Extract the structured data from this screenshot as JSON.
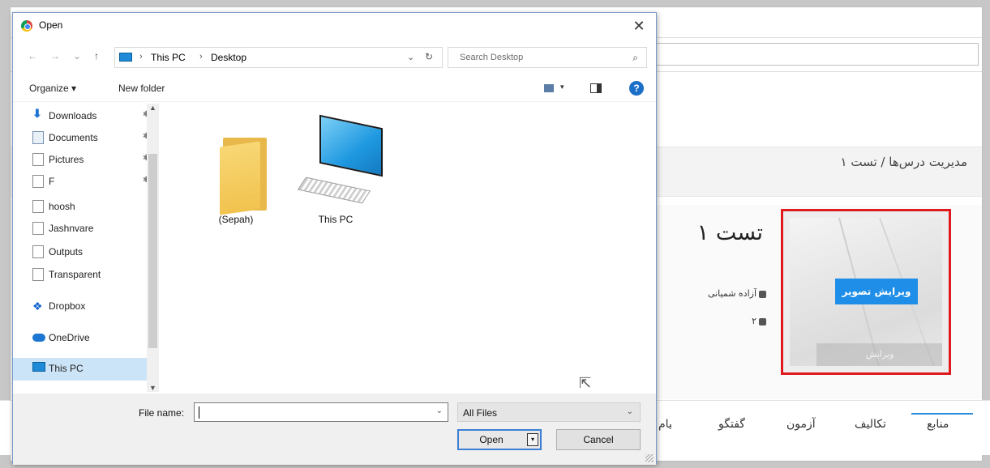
{
  "webpage": {
    "breadcrumb": "مدیریت درس‌ها / تست ۱",
    "lesson_title": "تست ۱",
    "author": "آزاده شمیانی",
    "count": "۲",
    "edit_image_button": "ویرایش تصویر",
    "image_caption": "ویرایش",
    "tabs": [
      "منابع",
      "تکالیف",
      "آزمون",
      "گفتگو",
      "پیام"
    ],
    "active_tab": "منابع",
    "highlight_color": "#e0191f",
    "accent_color": "#1f8ee8"
  },
  "dialog": {
    "title": "Open",
    "close_symbol": "✕",
    "nav": {
      "back": "←",
      "forward": "→",
      "recent": "⌄",
      "up": "↑"
    },
    "address": {
      "segments": [
        "This PC",
        "Desktop"
      ],
      "separator": "›",
      "dropdown": "⌄",
      "refresh": "↻"
    },
    "search": {
      "placeholder": "Search Desktop",
      "icon": "⌕"
    },
    "toolbar": {
      "organize": "Organize ▾",
      "new_folder": "New folder",
      "view_drop": "▾",
      "help": "?"
    },
    "nav_pane": {
      "items": [
        {
          "label": "Downloads",
          "icon": "download-icon",
          "pinned": true
        },
        {
          "label": "Documents",
          "icon": "documents-icon",
          "pinned": true
        },
        {
          "label": "Pictures",
          "icon": "document-icon",
          "pinned": true
        },
        {
          "label": "F",
          "icon": "document-icon",
          "pinned": true
        },
        {
          "label": "hoosh",
          "icon": "document-icon",
          "pinned": false
        },
        {
          "label": "Jashnvare",
          "icon": "document-icon",
          "pinned": false
        },
        {
          "label": "Outputs",
          "icon": "document-icon",
          "pinned": false
        },
        {
          "label": "Transparent",
          "icon": "document-icon",
          "pinned": false
        },
        {
          "label": "Dropbox",
          "icon": "dropbox-icon",
          "pinned": false
        },
        {
          "label": "OneDrive",
          "icon": "onedrive-icon",
          "pinned": false
        },
        {
          "label": "This PC",
          "icon": "this-pc-icon",
          "pinned": false,
          "selected": true
        }
      ],
      "pin_symbol": "📌"
    },
    "files": [
      {
        "name": "(Sepah)",
        "type": "folder"
      },
      {
        "name": "This PC",
        "type": "computer"
      }
    ],
    "file_name": {
      "label": "File name:",
      "value": "",
      "dropdown": "⌄"
    },
    "file_type": {
      "value": "All Files",
      "dropdown": "⌄"
    },
    "buttons": {
      "open": "Open",
      "open_split": "▾",
      "cancel": "Cancel"
    }
  }
}
